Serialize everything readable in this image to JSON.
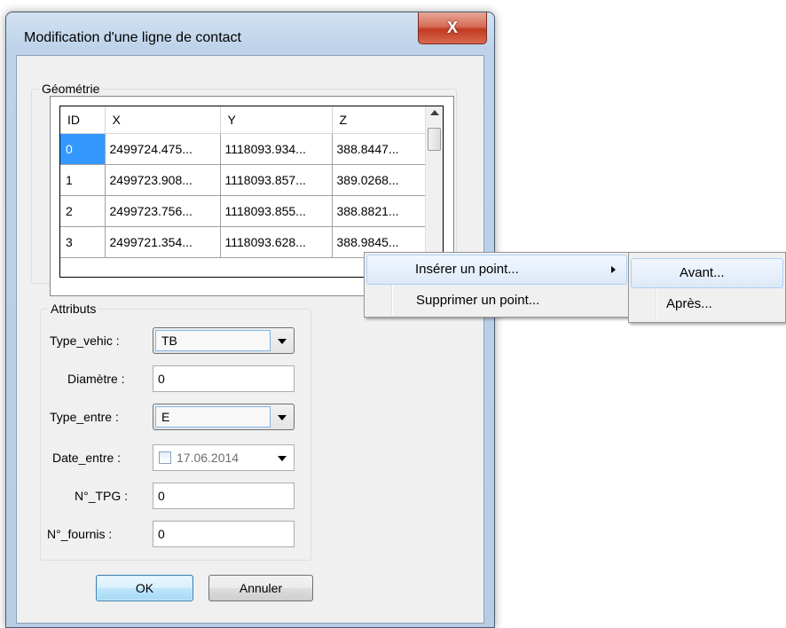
{
  "window": {
    "title": "Modification d'une ligne de contact",
    "close_glyph": "X"
  },
  "geometry_group": {
    "label": "Géométrie",
    "columns": [
      "ID",
      "X",
      "Y",
      "Z"
    ],
    "rows": [
      {
        "id": "0",
        "x": "2499724.475...",
        "y": "1118093.934...",
        "z": "388.8447..."
      },
      {
        "id": "1",
        "x": "2499723.908...",
        "y": "1118093.857...",
        "z": "389.0268..."
      },
      {
        "id": "2",
        "x": "2499723.756...",
        "y": "1118093.855...",
        "z": "388.8821..."
      },
      {
        "id": "3",
        "x": "2499721.354...",
        "y": "1118093.628...",
        "z": "388.9845..."
      }
    ],
    "selected_row": "0"
  },
  "attributes_group": {
    "label": "Attributs",
    "type_vehic": {
      "label": "Type_vehic :",
      "value": "TB"
    },
    "diametre": {
      "label": "Diamètre :",
      "value": "0"
    },
    "type_entre": {
      "label": "Type_entre :",
      "value": "E"
    },
    "date_entre": {
      "label": "Date_entre :",
      "value": "17.06.2014"
    },
    "n_tpg": {
      "label": "N°_TPG :",
      "value": "0"
    },
    "n_fournis": {
      "label": "N°_fournis :",
      "value": "0"
    }
  },
  "buttons": {
    "ok": "OK",
    "cancel": "Annuler"
  },
  "context_menu": {
    "items": [
      "Insérer un point...",
      "Supprimer un point..."
    ],
    "submenu": [
      "Avant...",
      "Après..."
    ]
  },
  "colors": {
    "selection": "#3399ff",
    "menu_highlight": "#dde9f8",
    "close_button": "#c23a22"
  }
}
